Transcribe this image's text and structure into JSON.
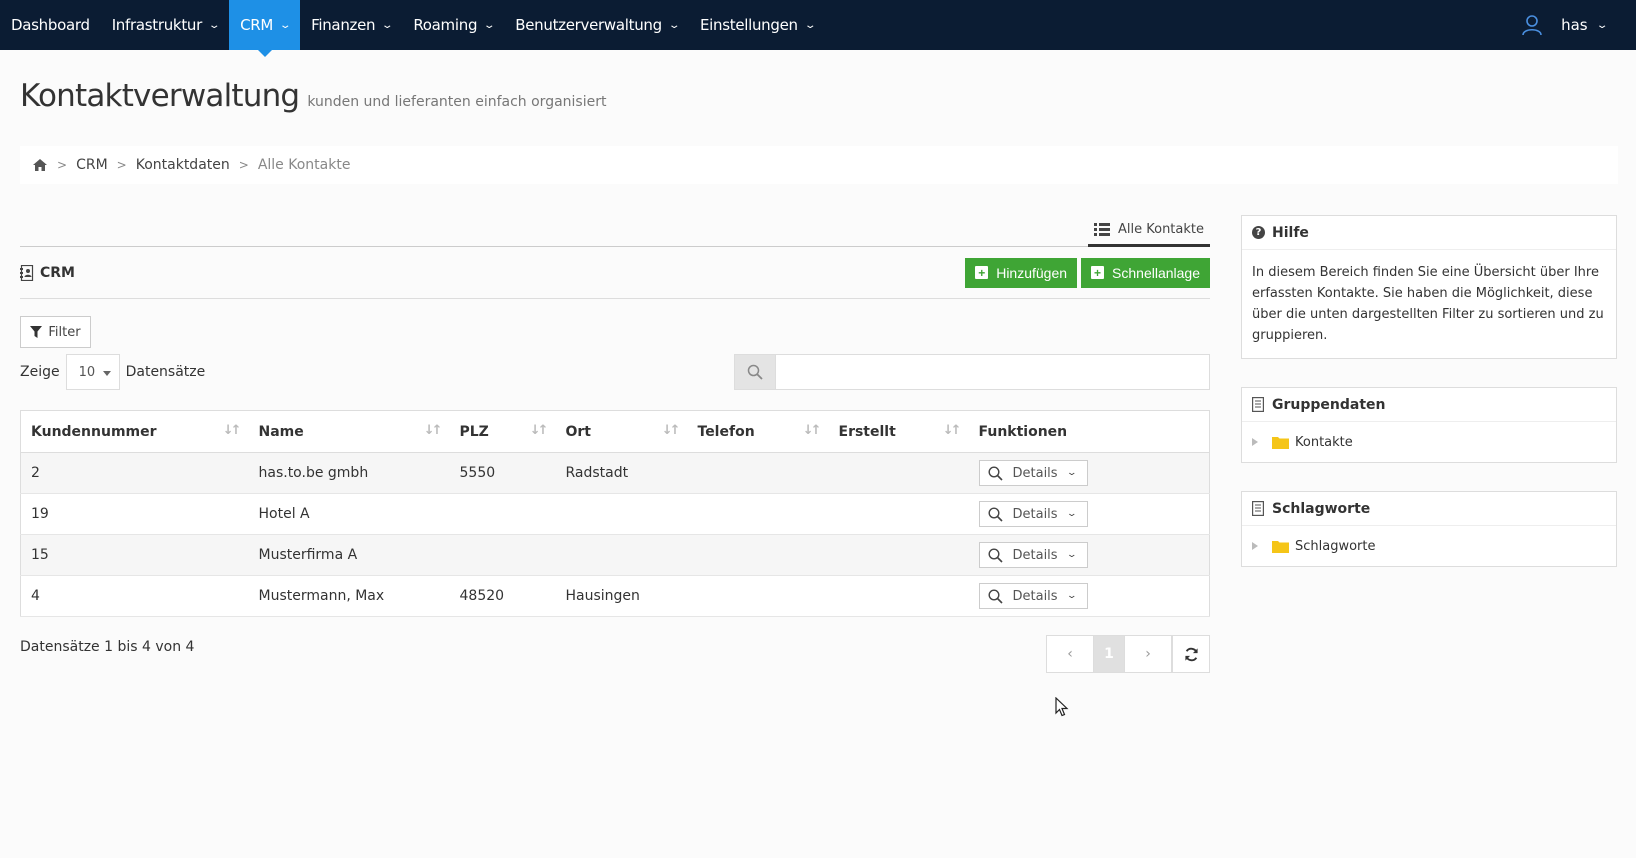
{
  "nav": {
    "items": [
      {
        "label": "Dashboard",
        "dropdown": false,
        "active": false
      },
      {
        "label": "Infrastruktur",
        "dropdown": true,
        "active": false
      },
      {
        "label": "CRM",
        "dropdown": true,
        "active": true
      },
      {
        "label": "Finanzen",
        "dropdown": true,
        "active": false
      },
      {
        "label": "Roaming",
        "dropdown": true,
        "active": false
      },
      {
        "label": "Benutzerverwaltung",
        "dropdown": true,
        "active": false
      },
      {
        "label": "Einstellungen",
        "dropdown": true,
        "active": false
      }
    ],
    "user": "has"
  },
  "header": {
    "title": "Kontaktverwaltung",
    "subtitle": "kunden und lieferanten einfach organisiert"
  },
  "breadcrumb": {
    "items": [
      "CRM",
      "Kontaktdaten"
    ],
    "current": "Alle Kontakte"
  },
  "tabs": {
    "active": "Alle Kontakte"
  },
  "section": {
    "label": "CRM",
    "add_label": "Hinzufügen",
    "quick_label": "Schnellanlage"
  },
  "filter": {
    "label": "Filter"
  },
  "length": {
    "prefix": "Zeige",
    "value": "10",
    "suffix": "Datensätze"
  },
  "search": {
    "value": ""
  },
  "table": {
    "columns": [
      "Kundennummer",
      "Name",
      "PLZ",
      "Ort",
      "Telefon",
      "Erstellt",
      "Funktionen"
    ],
    "rows": [
      {
        "id": "2",
        "name": "has.to.be gmbh",
        "plz": "5550",
        "ort": "Radstadt",
        "telefon": "",
        "erstellt": ""
      },
      {
        "id": "19",
        "name": "Hotel A",
        "plz": "",
        "ort": "",
        "telefon": "",
        "erstellt": ""
      },
      {
        "id": "15",
        "name": "Musterfirma A",
        "plz": "",
        "ort": "",
        "telefon": "",
        "erstellt": ""
      },
      {
        "id": "4",
        "name": "Mustermann, Max",
        "plz": "48520",
        "ort": "Hausingen",
        "telefon": "",
        "erstellt": ""
      }
    ],
    "details_label": "Details"
  },
  "footer": {
    "info": "Datensätze 1 bis 4 von 4",
    "page": "1",
    "prev": "‹",
    "next": "›"
  },
  "sidebar": {
    "help_title": "Hilfe",
    "help_text": "In diesem Bereich finden Sie eine Übersicht über Ihre erfassten Kontakte. Sie haben die Möglichkeit, diese über die unten dargestellten Filter zu sortieren und zu gruppieren.",
    "groups_title": "Gruppendaten",
    "groups_item": "Kontakte",
    "tags_title": "Schlagworte",
    "tags_item": "Schlagworte"
  },
  "colors": {
    "nav_bg": "#0b1c33",
    "nav_active": "#1e90e6",
    "btn_green": "#3fa535",
    "folder": "#f5c518"
  }
}
